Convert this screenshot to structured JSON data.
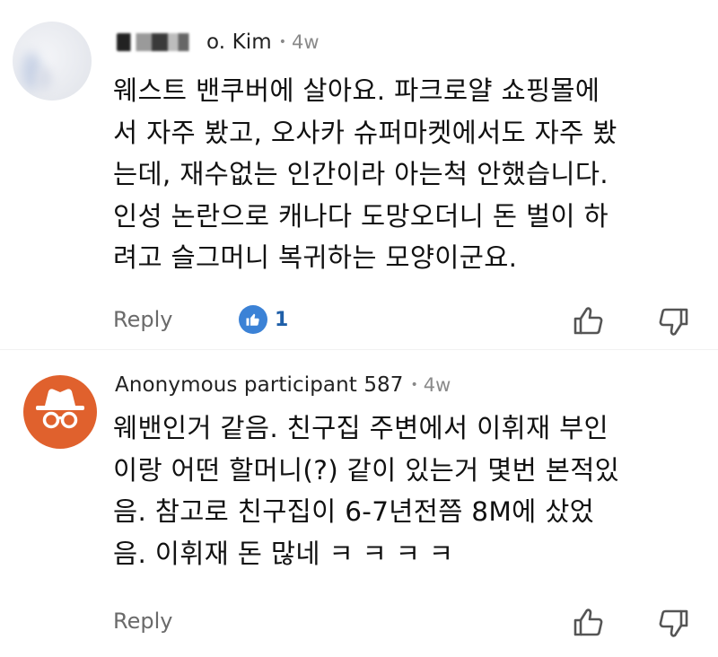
{
  "comments": [
    {
      "author": "o. Kim",
      "author_prefix_redacted": true,
      "separator": "•",
      "time": "4w",
      "text": "웨스트 밴쿠버에 살아요. 파크로얄 쇼핑몰에\n서 자주 봤고, 오사카 슈퍼마켓에서도 자주 봤\n는데, 재수없는 인간이라 아는척 안했습니다.\n인성 논란으로 캐나다 도망오더니 돈 벌이 하\n려고 슬그머니 복귀하는 모양이군요.",
      "reply_label": "Reply",
      "like_count": "1"
    },
    {
      "author": "Anonymous participant 587",
      "separator": "•",
      "time": "4w",
      "text": "웨밴인거 같음. 친구집 주변에서 이휘재 부인\n이랑 어떤 할머니(?) 같이 있는거 몇번 본적있\n음. 참고로 친구집이 6-7년전쯤 8M에 샀었\n음. 이휘재 돈 많네 ㅋ ㅋ ㅋ ㅋ",
      "reply_label": "Reply"
    }
  ],
  "icons": {
    "avatar_2": "anonymous-incognito-icon",
    "like_badge": "thumbs-up-icon",
    "upvote": "thumbs-up-outline-icon",
    "downvote": "thumbs-down-outline-icon"
  },
  "colors": {
    "anonymous_avatar": "#e0612d",
    "like_badge": "#3b82d6",
    "like_count": "#1f5fa8",
    "meta_gray": "#8a8a8a"
  }
}
